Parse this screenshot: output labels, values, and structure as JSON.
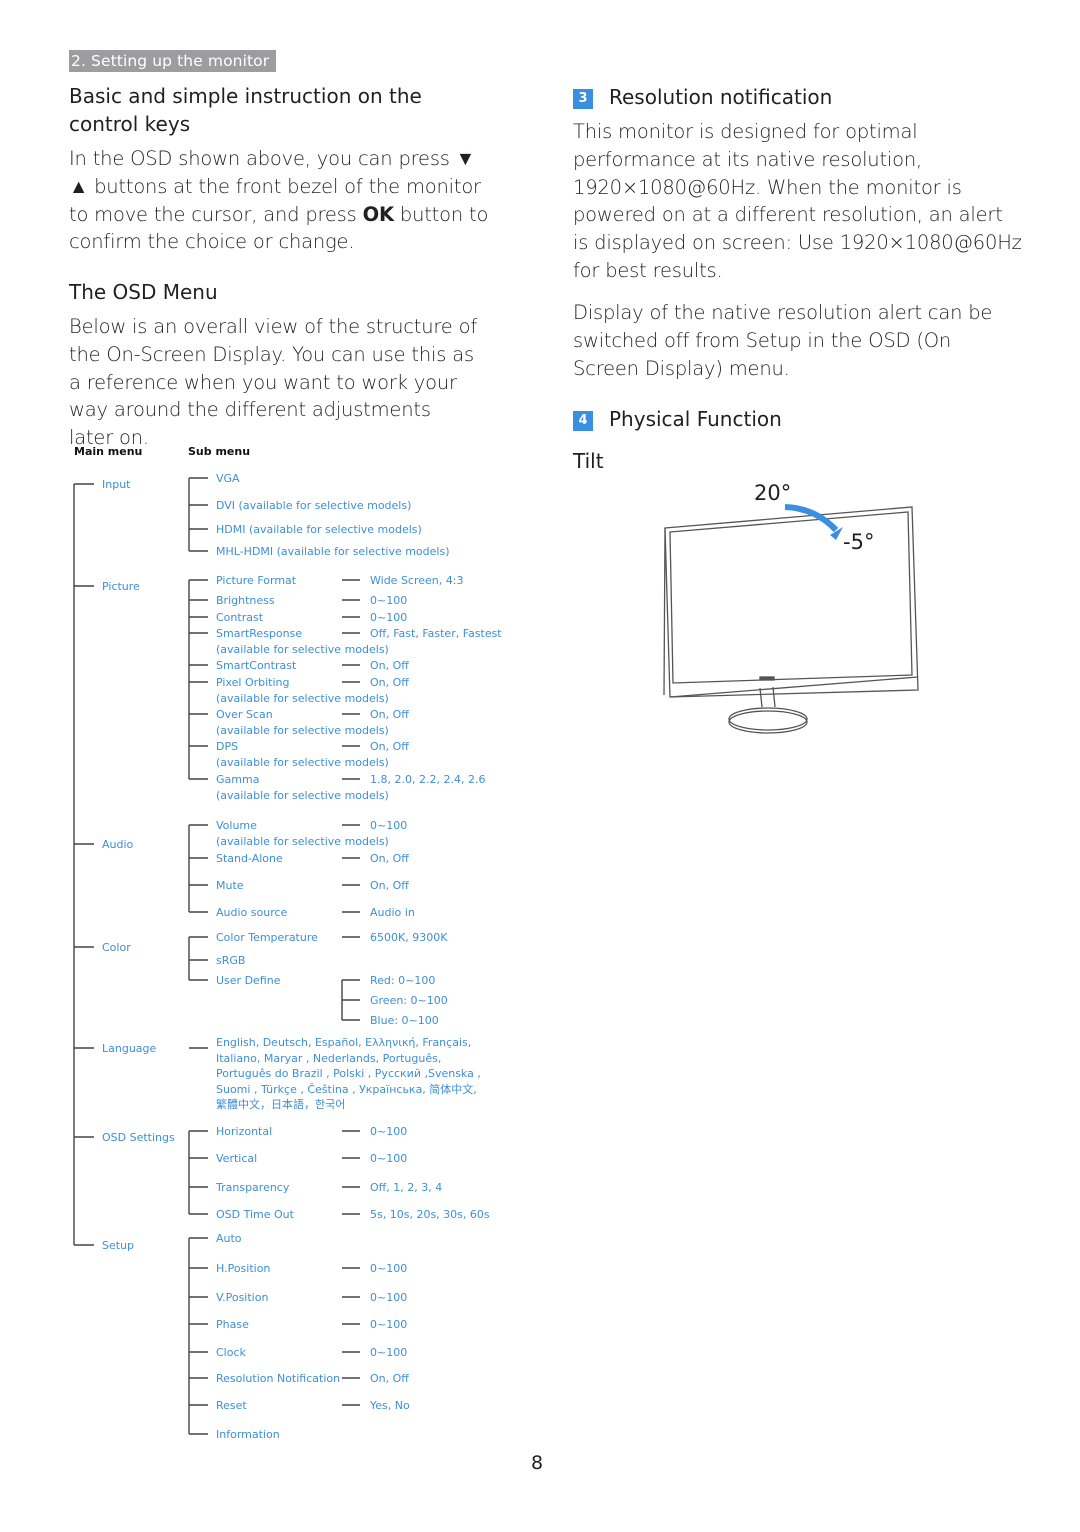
{
  "header": {
    "section_tab": "2. Setting up the monitor"
  },
  "left": {
    "heading_keys": "Basic and simple instruction on the control keys",
    "keys_para": {
      "line1": "In the OSD shown above, you can press ▼",
      "line2": "▲ buttons at the front bezel of the monitor",
      "line3_pre": "to move the cursor, and press ",
      "line3_bold": "OK",
      "line3_post": " button to",
      "line4": "confirm the choice or change."
    },
    "heading_osd": "The OSD Menu",
    "osd_para": "Below is an overall view of the structure of the On-Screen Display. You can use this as a reference when you want to work your way around the different adjustments later on."
  },
  "osd_tree": {
    "col_main": "Main menu",
    "col_sub": "Sub menu",
    "main": [
      {
        "label": "Input"
      },
      {
        "label": "Picture"
      },
      {
        "label": "Audio"
      },
      {
        "label": "Color"
      },
      {
        "label": "Language"
      },
      {
        "label": "OSD Settings"
      },
      {
        "label": "Setup"
      }
    ],
    "input_sub": [
      "VGA",
      "DVI (available for selective models)",
      "HDMI (available for selective models)",
      "MHL-HDMI (available for selective models)"
    ],
    "picture_sub": [
      {
        "label": "Picture Format",
        "value": "Wide Screen, 4:3"
      },
      {
        "label": "Brightness",
        "value": "0~100"
      },
      {
        "label": "Contrast",
        "value": "0~100"
      },
      {
        "label": "SmartResponse",
        "value": "Off, Fast, Faster, Fastest",
        "note": "(available for selective models)"
      },
      {
        "label": "SmartContrast",
        "value": "On, Off"
      },
      {
        "label": "Pixel Orbiting",
        "value": "On, Off",
        "note": "(available for selective models)"
      },
      {
        "label": "Over Scan",
        "value": "On, Off",
        "note": "(available for selective models)"
      },
      {
        "label": "DPS",
        "value": "On, Off",
        "note": "(available for selective models)"
      },
      {
        "label": "Gamma",
        "value": "1.8, 2.0, 2.2, 2.4, 2.6",
        "note": "(available for selective models)"
      }
    ],
    "audio_sub": [
      {
        "label": "Volume",
        "value": "0~100",
        "note": "(available for selective models)"
      },
      {
        "label": "Stand-Alone",
        "value": "On, Off"
      },
      {
        "label": "Mute",
        "value": "On, Off"
      },
      {
        "label": "Audio source",
        "value": "Audio in"
      }
    ],
    "color_sub": [
      {
        "label": "Color Temperature",
        "value": "6500K, 9300K"
      },
      {
        "label": "sRGB"
      },
      {
        "label": "User Define"
      }
    ],
    "user_define": [
      "Red: 0~100",
      "Green: 0~100",
      "Blue: 0~100"
    ],
    "languages": [
      "English, Deutsch, Español, Ελληνική, Français,",
      "Italiano,  Maryar ,  Nederlands, Português,",
      "Português do Brazil ,  Polski ,  Русский ,Svenska ,",
      "Suomi ,  Türkçe ,  Čeština ,  Українська, 简体中文,",
      "繁體中文，日本語，한국어"
    ],
    "osd_sub": [
      {
        "label": "Horizontal",
        "value": "0~100"
      },
      {
        "label": "Vertical",
        "value": "0~100"
      },
      {
        "label": "Transparency",
        "value": "Off, 1, 2, 3, 4"
      },
      {
        "label": "OSD Time Out",
        "value": "5s, 10s, 20s, 30s, 60s"
      }
    ],
    "setup_sub": [
      {
        "label": "Auto"
      },
      {
        "label": "H.Position",
        "value": "0~100"
      },
      {
        "label": "V.Position",
        "value": "0~100"
      },
      {
        "label": "Phase",
        "value": "0~100"
      },
      {
        "label": "Clock",
        "value": "0~100"
      },
      {
        "label": "Resolution Notification",
        "value": "On, Off"
      },
      {
        "label": "Reset",
        "value": "Yes, No"
      },
      {
        "label": "Information"
      }
    ]
  },
  "right": {
    "sec3_num": "3",
    "sec3_title": "Resolution notification",
    "sec3_para1": "This monitor is designed for optimal performance at its native resolution, 1920×1080@60Hz. When the monitor is powered on at a different resolution, an alert is displayed on screen: Use 1920×1080@60Hz for best results.",
    "sec3_para2": "Display of the native resolution alert can be switched off from Setup in the OSD (On Screen Display) menu.",
    "sec4_num": "4",
    "sec4_title": "Physical Function",
    "tilt_heading": "Tilt",
    "tilt_max": "20°",
    "tilt_min": "-5°"
  },
  "colors": {
    "accent": "#3b8fe0",
    "tree_text": "#3d8fd8",
    "tab_bg": "#9d9d9f"
  },
  "footer": {
    "page_number": "8"
  }
}
